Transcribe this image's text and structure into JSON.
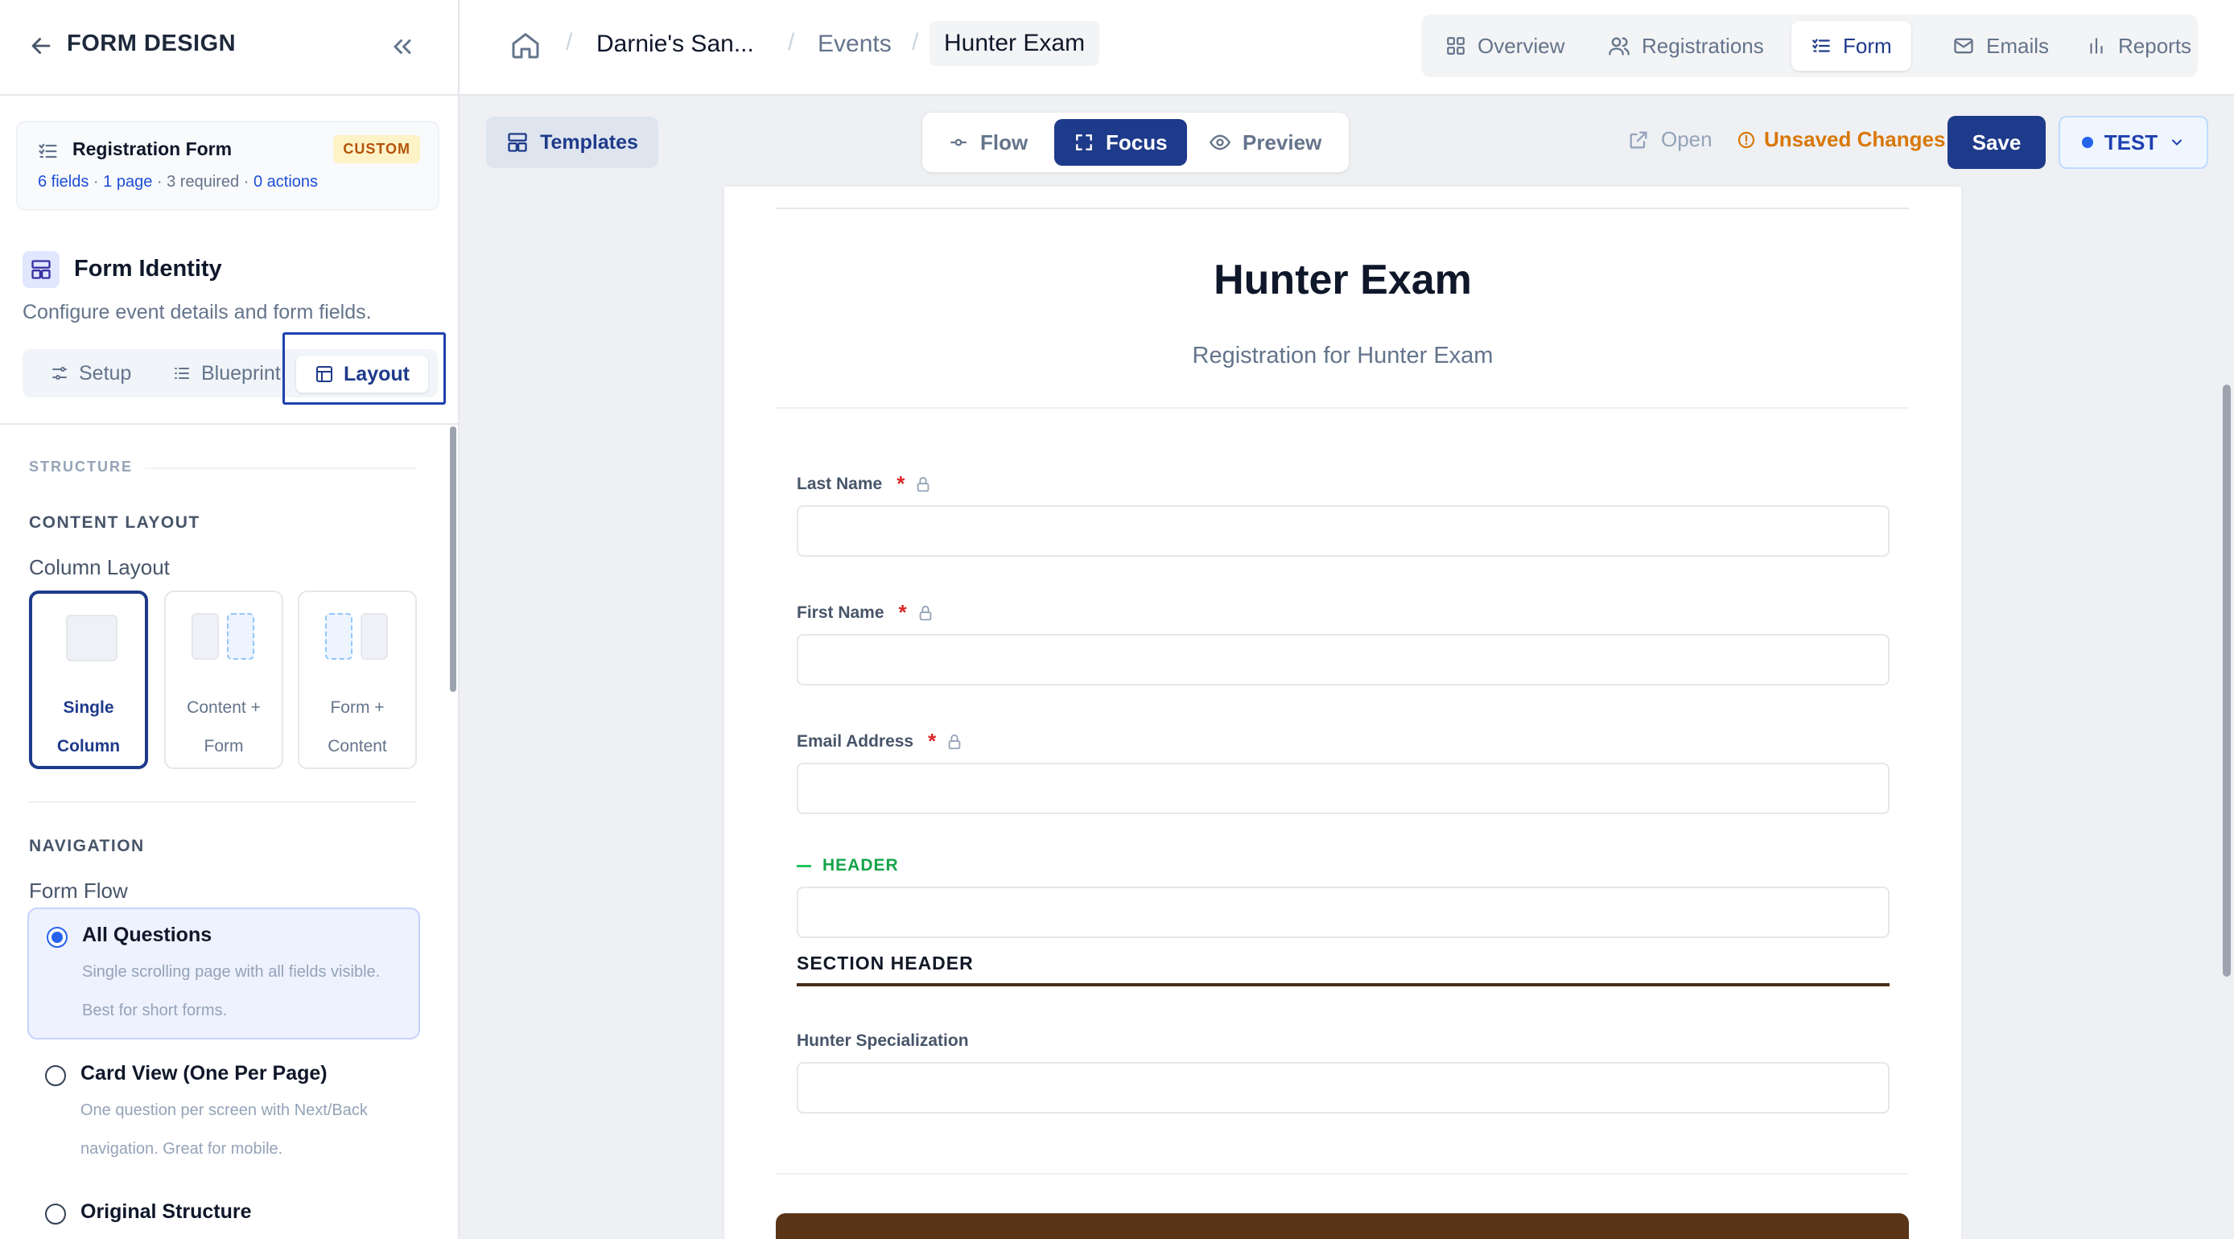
{
  "sidebar": {
    "title": "FORM DESIGN",
    "form_card": {
      "title": "Registration Form",
      "badge": "CUSTOM",
      "fields": "6 fields",
      "pages": "1 page",
      "required": "3 required",
      "actions": "0 actions",
      "separator": " · "
    },
    "identity": {
      "title": "Form Identity",
      "subtitle": "Configure event details and form fields."
    },
    "tabs": {
      "setup": "Setup",
      "blueprint": "Blueprint",
      "layout": "Layout",
      "active": "Layout"
    },
    "structure_label": "STRUCTURE",
    "content_layout": {
      "heading": "CONTENT LAYOUT",
      "label": "Column Layout",
      "options": [
        {
          "line1": "Single",
          "line2": "Column",
          "selected": true
        },
        {
          "line1": "Content +",
          "line2": "Form",
          "selected": false
        },
        {
          "line1": "Form +",
          "line2": "Content",
          "selected": false
        }
      ]
    },
    "navigation": {
      "heading": "NAVIGATION",
      "label": "Form Flow",
      "options": [
        {
          "title": "All Questions",
          "desc": "Single scrolling page with all fields visible. Best for short forms.",
          "selected": true
        },
        {
          "title": "Card View (One Per Page)",
          "desc": "One question per screen with Next/Back navigation. Great for mobile.",
          "selected": false
        },
        {
          "title": "Original Structure",
          "desc": "",
          "selected": false
        }
      ]
    }
  },
  "topbar": {
    "breadcrumb": [
      "Darnie's San...",
      "Events",
      "Hunter Exam"
    ],
    "separator": "/",
    "nav_tabs": [
      "Overview",
      "Registrations",
      "Form",
      "Emails",
      "Reports"
    ],
    "active_nav": "Form"
  },
  "toolbar": {
    "templates": "Templates",
    "modes": [
      "Flow",
      "Focus",
      "Preview"
    ],
    "active_mode": "Focus",
    "open": "Open",
    "unsaved": "Unsaved Changes",
    "save": "Save",
    "env": "TEST"
  },
  "form_preview": {
    "title": "Hunter Exam",
    "subtitle": "Registration for Hunter Exam",
    "fields": [
      {
        "label": "Last Name",
        "required": true,
        "locked": true,
        "value": ""
      },
      {
        "label": "First Name",
        "required": true,
        "locked": true,
        "value": ""
      },
      {
        "label": "Email Address",
        "required": true,
        "locked": true,
        "value": ""
      }
    ],
    "header_tag": "HEADER",
    "section_header": "SECTION HEADER",
    "extra_field": {
      "label": "Hunter Specialization",
      "value": ""
    },
    "required_mark": "*"
  },
  "colors": {
    "primary": "#1e3a8a",
    "warning": "#d97706",
    "header_tag": "#16a34a",
    "section_rule": "#4a2e17",
    "submit_bar": "#5a3417",
    "badge_bg": "#fef3c7",
    "badge_text": "#b45309"
  }
}
